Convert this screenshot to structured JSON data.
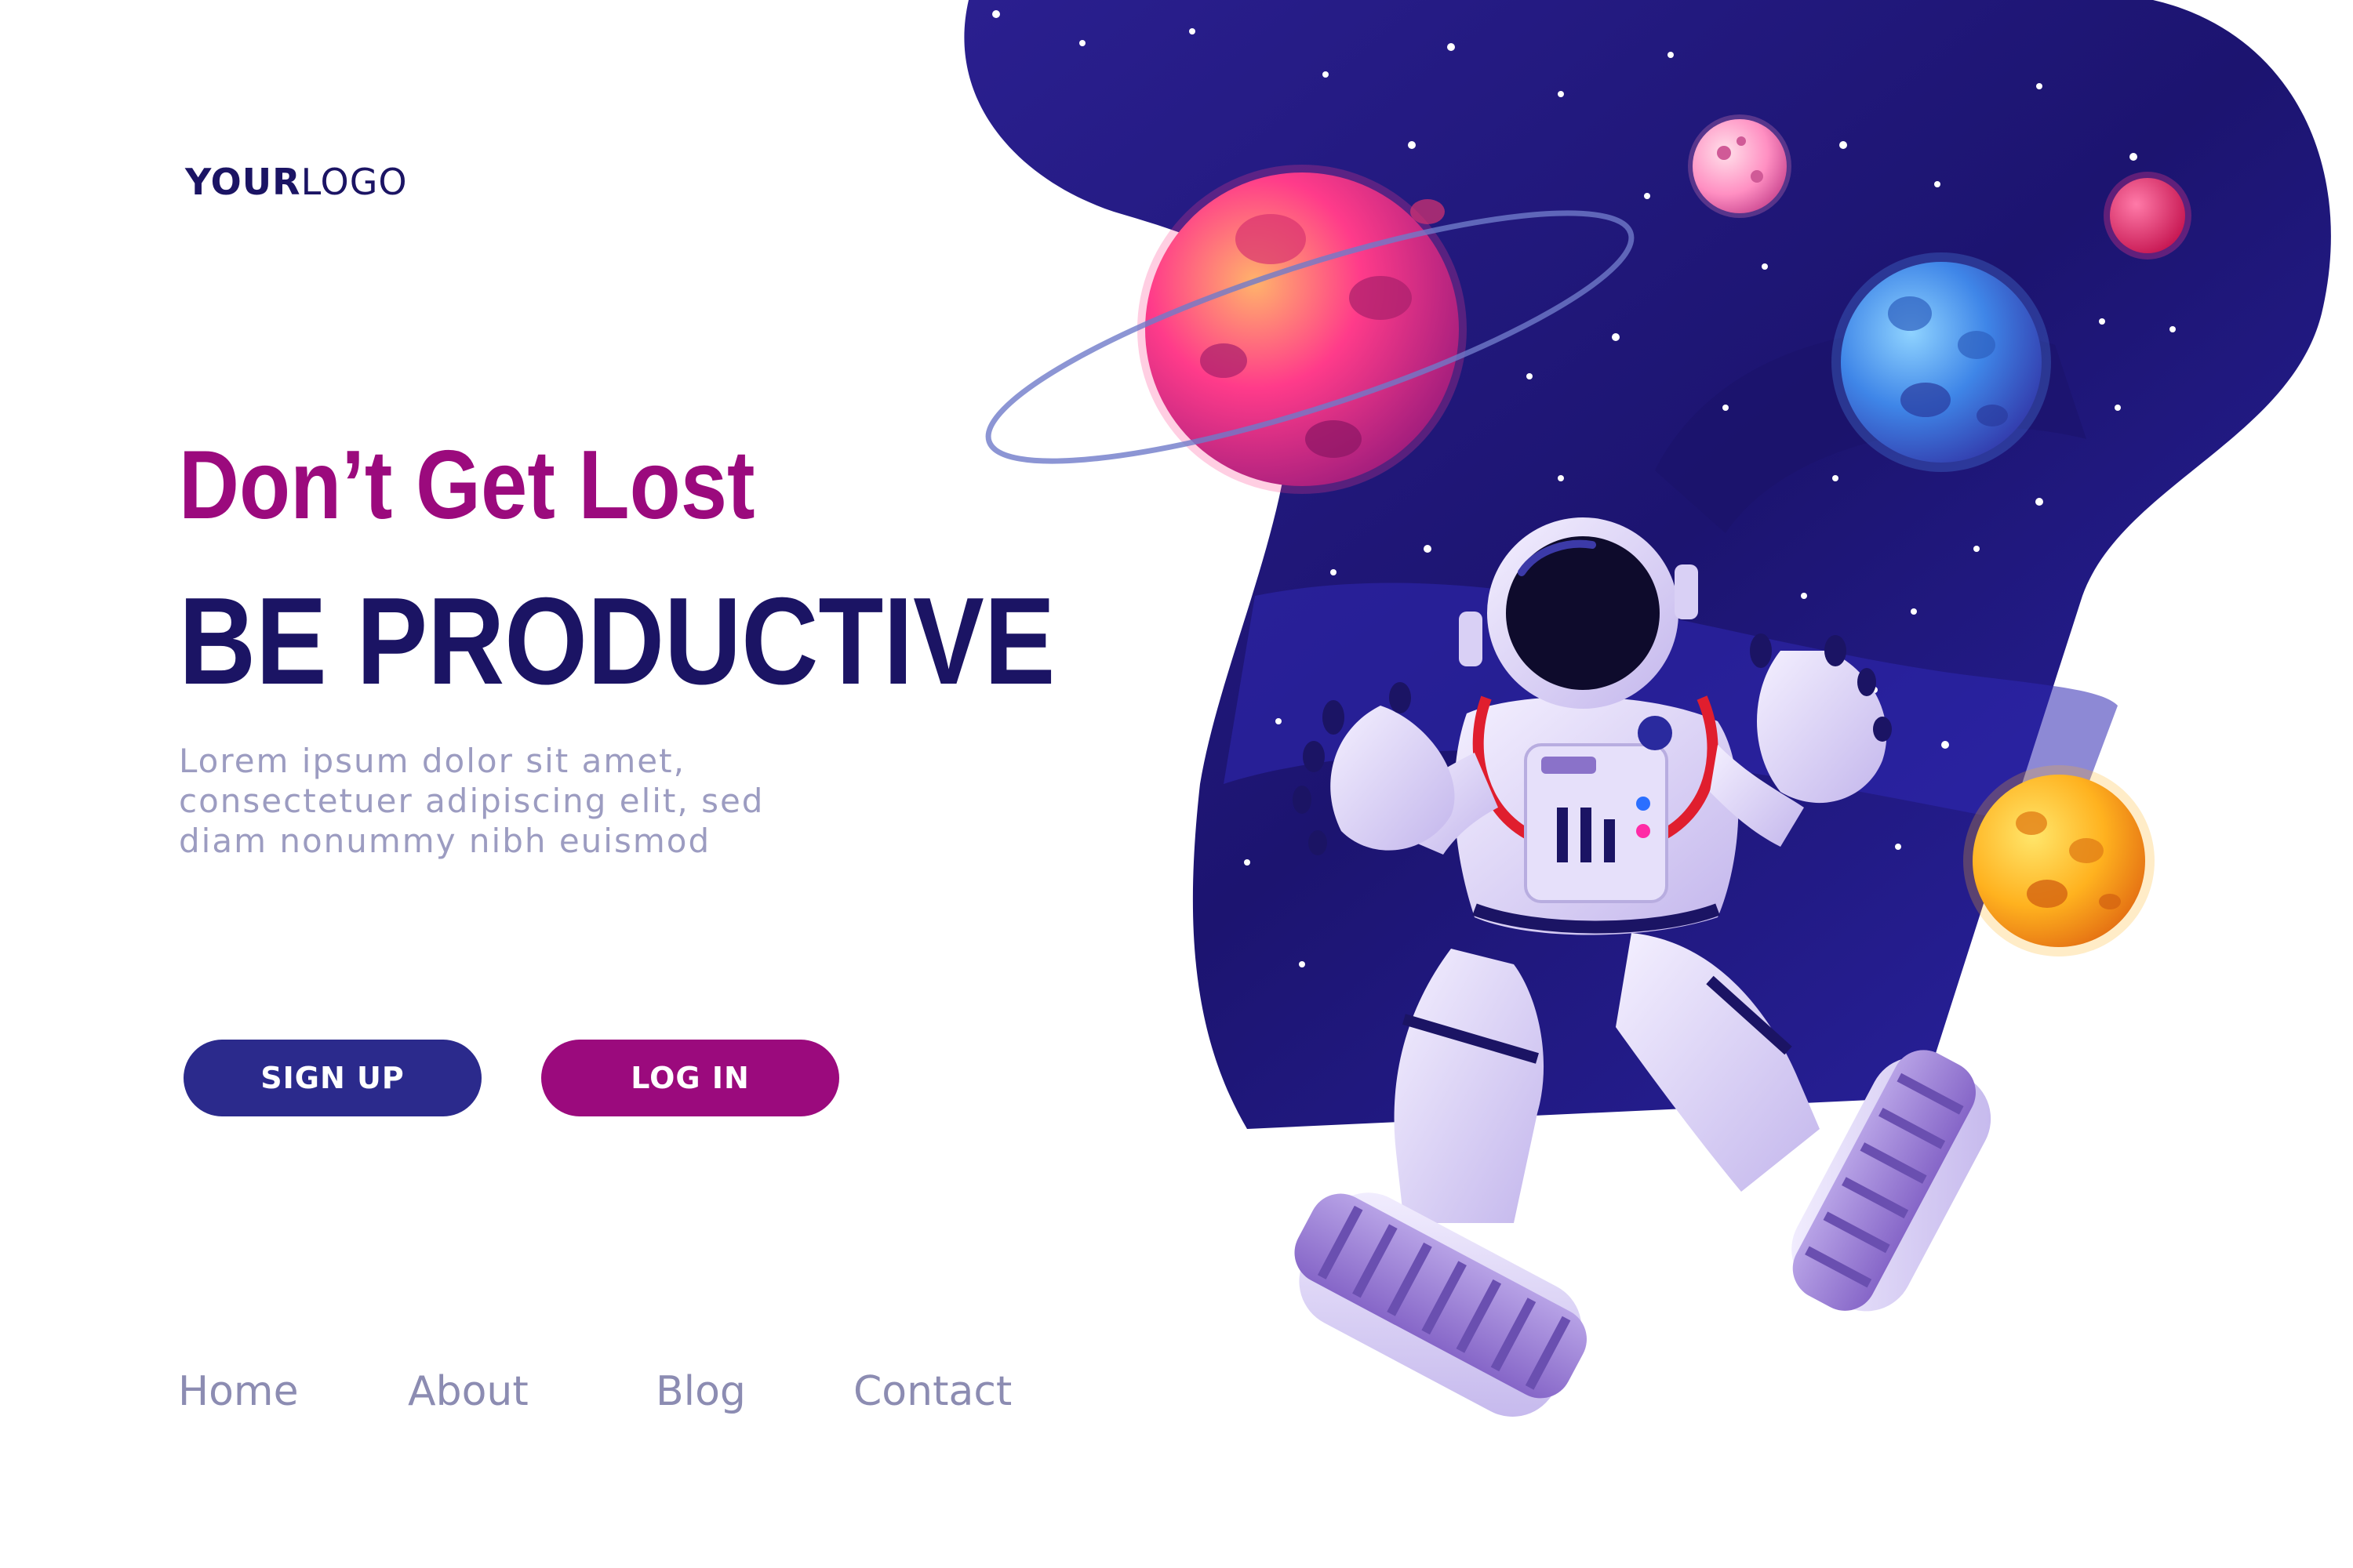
{
  "logo": {
    "bold": "YOUR",
    "light": "LOGO"
  },
  "hero": {
    "headline": "Don’t Get Lost",
    "subheadline": "BE PRODUCTIVE",
    "body_lines": [
      "Lorem ipsum dolor sit amet,",
      "consectetuer adipiscing elit, sed",
      "diam nonummy nibh euismod"
    ]
  },
  "buttons": {
    "signup": "SIGN UP",
    "login": "LOG IN"
  },
  "nav": {
    "home": "Home",
    "about": "About",
    "blog": "Blog",
    "contact": "Contact"
  },
  "colors": {
    "brand_dark": "#1b1464",
    "accent_magenta": "#9b0a7d",
    "button_blue": "#2b2a8c",
    "muted_text": "#9c9cc1",
    "space_deep": "#14105a",
    "space_mid": "#2a1f9e"
  },
  "illustration": {
    "subject": "astronaut floating in space",
    "planets": [
      "planet-pink-ringed",
      "planet-pink-small",
      "planet-red-small",
      "planet-blue",
      "planet-orange"
    ]
  }
}
